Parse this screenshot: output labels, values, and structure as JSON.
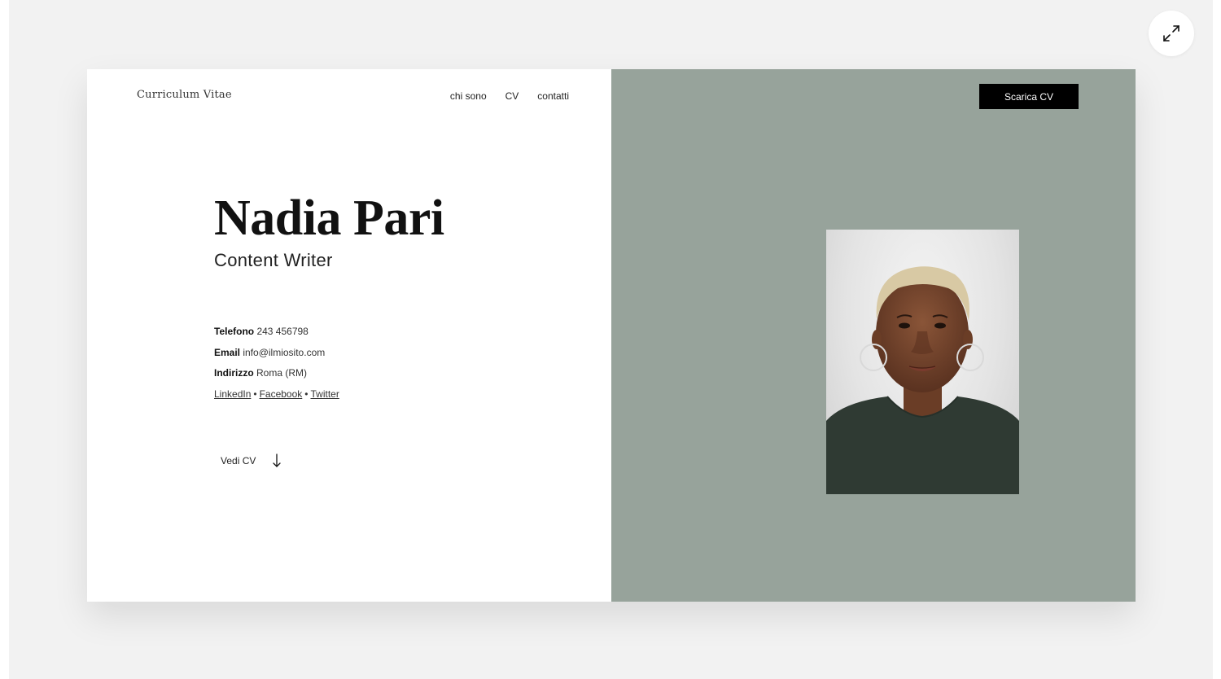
{
  "card": {
    "brand": "Curriculum Vitae",
    "nav": [
      "chi sono",
      "CV",
      "contatti"
    ],
    "name": "Nadia Pari",
    "role": "Content Writer",
    "contacts": {
      "phone_label": "Telefono",
      "phone_value": "243 456798",
      "email_label": "Email",
      "email_value": "info@ilmiosito.com",
      "address_label": "Indirizzo",
      "address_value": "Roma (RM)"
    },
    "socials": [
      "LinkedIn",
      "Facebook",
      "Twitter"
    ],
    "social_separator": "•",
    "view_cv_label": "Vedi CV",
    "download_label": "Scarica CV"
  },
  "colors": {
    "page_bg": "#f2f2f2",
    "card_bg": "#ffffff",
    "accent_pane": "#97a39b",
    "button_bg": "#000000",
    "shirt": "#2f3a33"
  },
  "icons": {
    "expand": "expand-arrows-icon",
    "arrow_down": "arrow-down-icon"
  }
}
